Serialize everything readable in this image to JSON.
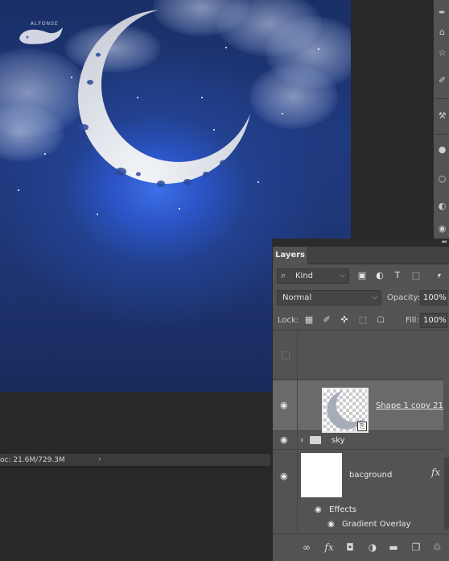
{
  "status": {
    "doc_info": "oc: 21.6M/729.3M",
    "arrow_icon": "chevron-right-icon"
  },
  "watermark": {
    "text": "ALFONSE"
  },
  "toolbar": {
    "icons": [
      "brush-icon",
      "clone-stamp-icon",
      "history-brush-icon",
      "eraser-icon",
      "paint-bucket-icon",
      "blur-icon",
      "dodge-icon",
      "pen-icon"
    ]
  },
  "layers_panel": {
    "tab_label": "Layers",
    "filter": {
      "search_icon": "search-icon",
      "kind_label": "Kind"
    },
    "blend_mode": "Normal",
    "opacity_label": "Opacity:",
    "opacity_value": "100%",
    "lock_label": "Lock:",
    "fill_label": "Fill:",
    "fill_value": "100%",
    "layers": [
      {
        "name": "Shape 1 copy 21",
        "selected": true,
        "visible": true
      },
      {
        "name": "sky",
        "type": "group",
        "visible": true
      },
      {
        "name": "bacground",
        "visible": true,
        "has_fx": true,
        "fx_label": "fx"
      }
    ],
    "effects_label": "Effects",
    "gradient_overlay_label": "Gradient Overlay"
  },
  "colors": {
    "panel_bg": "#535353",
    "selected_row": "#6a6a6a",
    "canvas_glow": "#3d6fe6",
    "canvas_dark": "#1a2b5c"
  }
}
